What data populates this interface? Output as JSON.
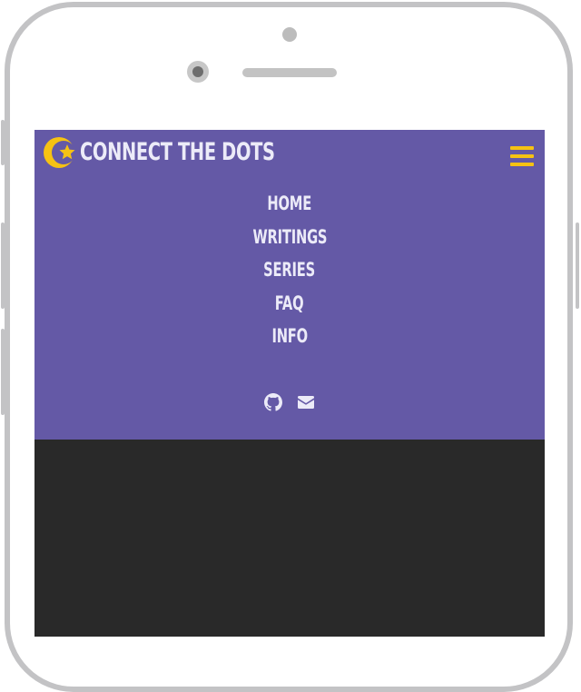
{
  "site": {
    "brand": "CONNECT THE DOTS",
    "logo_icon": "crescent-star-logo",
    "menu_icon": "hamburger-menu-icon"
  },
  "nav": {
    "items": [
      {
        "label": "HOME"
      },
      {
        "label": "WRITINGS"
      },
      {
        "label": "SERIES"
      },
      {
        "label": "FAQ"
      },
      {
        "label": "INFO"
      }
    ]
  },
  "social": [
    {
      "icon": "github-icon"
    },
    {
      "icon": "email-icon"
    }
  ],
  "colors": {
    "header_bg": "#6459a6",
    "accent": "#f6c213",
    "nav_text": "#ecebf8",
    "content_bg": "#292929",
    "frame": "#c3c3c5"
  }
}
